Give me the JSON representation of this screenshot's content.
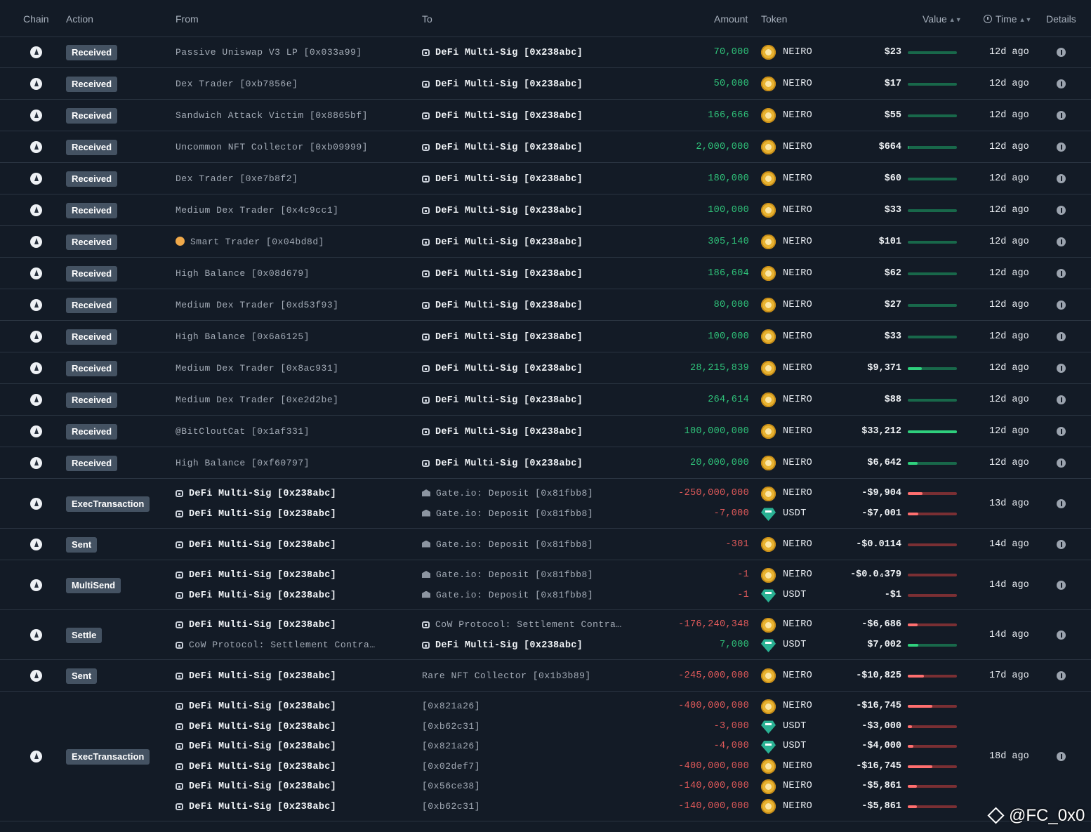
{
  "header": {
    "chain": "Chain",
    "action": "Action",
    "from": "From",
    "to": "To",
    "amount": "Amount",
    "token": "Token",
    "value": "Value",
    "time": "Time",
    "details": "Details"
  },
  "colors": {
    "positive": "#2fc37a",
    "negative": "#e05a5a",
    "badge": "#445262",
    "background": "#131b26"
  },
  "rows": [
    {
      "action": "Received",
      "time": "12d ago",
      "lines": [
        {
          "from": "Passive Uniswap V3 LP [0x033a99]",
          "from_icon": "",
          "from_bright": false,
          "to": "DeFi Multi-Sig [0x238abc]",
          "to_icon": "safe-icon",
          "to_bright": true,
          "amount": "70,000",
          "sign": "pos",
          "token": "NEIRO",
          "coin": "neiro",
          "value": "$23",
          "bar": 0.0
        }
      ]
    },
    {
      "action": "Received",
      "time": "12d ago",
      "lines": [
        {
          "from": "Dex Trader [0xb7856e]",
          "from_icon": "",
          "from_bright": false,
          "to": "DeFi Multi-Sig [0x238abc]",
          "to_icon": "safe-icon",
          "to_bright": true,
          "amount": "50,000",
          "sign": "pos",
          "token": "NEIRO",
          "coin": "neiro",
          "value": "$17",
          "bar": 0.0
        }
      ]
    },
    {
      "action": "Received",
      "time": "12d ago",
      "lines": [
        {
          "from": "Sandwich Attack Victim [0x8865bf]",
          "from_icon": "",
          "from_bright": false,
          "to": "DeFi Multi-Sig [0x238abc]",
          "to_icon": "safe-icon",
          "to_bright": true,
          "amount": "166,666",
          "sign": "pos",
          "token": "NEIRO",
          "coin": "neiro",
          "value": "$55",
          "bar": 0.0
        }
      ]
    },
    {
      "action": "Received",
      "time": "12d ago",
      "lines": [
        {
          "from": "Uncommon NFT Collector [0xb09999]",
          "from_icon": "",
          "from_bright": false,
          "to": "DeFi Multi-Sig [0x238abc]",
          "to_icon": "safe-icon",
          "to_bright": true,
          "amount": "2,000,000",
          "sign": "pos",
          "token": "NEIRO",
          "coin": "neiro",
          "value": "$664",
          "bar": 0.02
        }
      ]
    },
    {
      "action": "Received",
      "time": "12d ago",
      "lines": [
        {
          "from": "Dex Trader [0xe7b8f2]",
          "from_icon": "",
          "from_bright": false,
          "to": "DeFi Multi-Sig [0x238abc]",
          "to_icon": "safe-icon",
          "to_bright": true,
          "amount": "180,000",
          "sign": "pos",
          "token": "NEIRO",
          "coin": "neiro",
          "value": "$60",
          "bar": 0.0
        }
      ]
    },
    {
      "action": "Received",
      "time": "12d ago",
      "lines": [
        {
          "from": "Medium Dex Trader [0x4c9cc1]",
          "from_icon": "",
          "from_bright": false,
          "to": "DeFi Multi-Sig [0x238abc]",
          "to_icon": "safe-icon",
          "to_bright": true,
          "amount": "100,000",
          "sign": "pos",
          "token": "NEIRO",
          "coin": "neiro",
          "value": "$33",
          "bar": 0.0
        }
      ]
    },
    {
      "action": "Received",
      "time": "12d ago",
      "lines": [
        {
          "from": "Smart Trader [0x04bd8d]",
          "from_icon": "smiley-icon",
          "from_bright": false,
          "to": "DeFi Multi-Sig [0x238abc]",
          "to_icon": "safe-icon",
          "to_bright": true,
          "amount": "305,140",
          "sign": "pos",
          "token": "NEIRO",
          "coin": "neiro",
          "value": "$101",
          "bar": 0.0
        }
      ]
    },
    {
      "action": "Received",
      "time": "12d ago",
      "lines": [
        {
          "from": "High Balance [0x08d679]",
          "from_icon": "",
          "from_bright": false,
          "to": "DeFi Multi-Sig [0x238abc]",
          "to_icon": "safe-icon",
          "to_bright": true,
          "amount": "186,604",
          "sign": "pos",
          "token": "NEIRO",
          "coin": "neiro",
          "value": "$62",
          "bar": 0.0
        }
      ]
    },
    {
      "action": "Received",
      "time": "12d ago",
      "lines": [
        {
          "from": "Medium Dex Trader [0xd53f93]",
          "from_icon": "",
          "from_bright": false,
          "to": "DeFi Multi-Sig [0x238abc]",
          "to_icon": "safe-icon",
          "to_bright": true,
          "amount": "80,000",
          "sign": "pos",
          "token": "NEIRO",
          "coin": "neiro",
          "value": "$27",
          "bar": 0.0
        }
      ]
    },
    {
      "action": "Received",
      "time": "12d ago",
      "lines": [
        {
          "from": "High Balance [0x6a6125]",
          "from_icon": "",
          "from_bright": false,
          "to": "DeFi Multi-Sig [0x238abc]",
          "to_icon": "safe-icon",
          "to_bright": true,
          "amount": "100,000",
          "sign": "pos",
          "token": "NEIRO",
          "coin": "neiro",
          "value": "$33",
          "bar": 0.0
        }
      ]
    },
    {
      "action": "Received",
      "time": "12d ago",
      "lines": [
        {
          "from": "Medium Dex Trader [0x8ac931]",
          "from_icon": "",
          "from_bright": false,
          "to": "DeFi Multi-Sig [0x238abc]",
          "to_icon": "safe-icon",
          "to_bright": true,
          "amount": "28,215,839",
          "sign": "pos",
          "token": "NEIRO",
          "coin": "neiro",
          "value": "$9,371",
          "bar": 0.28
        }
      ]
    },
    {
      "action": "Received",
      "time": "12d ago",
      "lines": [
        {
          "from": "Medium Dex Trader [0xe2d2be]",
          "from_icon": "",
          "from_bright": false,
          "to": "DeFi Multi-Sig [0x238abc]",
          "to_icon": "safe-icon",
          "to_bright": true,
          "amount": "264,614",
          "sign": "pos",
          "token": "NEIRO",
          "coin": "neiro",
          "value": "$88",
          "bar": 0.0
        }
      ]
    },
    {
      "action": "Received",
      "time": "12d ago",
      "lines": [
        {
          "from": "@BitCloutCat [0x1af331]",
          "from_icon": "",
          "from_bright": false,
          "to": "DeFi Multi-Sig [0x238abc]",
          "to_icon": "safe-icon",
          "to_bright": true,
          "amount": "100,000,000",
          "sign": "pos",
          "token": "NEIRO",
          "coin": "neiro",
          "value": "$33,212",
          "bar": 1.0
        }
      ]
    },
    {
      "action": "Received",
      "time": "12d ago",
      "lines": [
        {
          "from": "High Balance [0xf60797]",
          "from_icon": "",
          "from_bright": false,
          "to": "DeFi Multi-Sig [0x238abc]",
          "to_icon": "safe-icon",
          "to_bright": true,
          "amount": "20,000,000",
          "sign": "pos",
          "token": "NEIRO",
          "coin": "neiro",
          "value": "$6,642",
          "bar": 0.2
        }
      ]
    },
    {
      "action": "ExecTransaction",
      "time": "13d ago",
      "lines": [
        {
          "from": "DeFi Multi-Sig [0x238abc]",
          "from_icon": "safe-icon",
          "from_bright": true,
          "to": "Gate.io: Deposit [0x81fbb8]",
          "to_icon": "bank-icon",
          "to_bright": false,
          "amount": "-250,000,000",
          "sign": "neg",
          "token": "NEIRO",
          "coin": "neiro",
          "value": "-$9,904",
          "bar": 0.3
        },
        {
          "from": "DeFi Multi-Sig [0x238abc]",
          "from_icon": "safe-icon",
          "from_bright": true,
          "to": "Gate.io: Deposit [0x81fbb8]",
          "to_icon": "bank-icon",
          "to_bright": false,
          "amount": "-7,000",
          "sign": "neg",
          "token": "USDT",
          "coin": "usdt",
          "value": "-$7,001",
          "bar": 0.21
        }
      ]
    },
    {
      "action": "Sent",
      "time": "14d ago",
      "lines": [
        {
          "from": "DeFi Multi-Sig [0x238abc]",
          "from_icon": "safe-icon",
          "from_bright": true,
          "to": "Gate.io: Deposit [0x81fbb8]",
          "to_icon": "bank-icon",
          "to_bright": false,
          "amount": "-301",
          "sign": "neg",
          "token": "NEIRO",
          "coin": "neiro",
          "value": "-$0.0114",
          "bar": 0.0
        }
      ]
    },
    {
      "action": "MultiSend",
      "time": "14d ago",
      "lines": [
        {
          "from": "DeFi Multi-Sig [0x238abc]",
          "from_icon": "safe-icon",
          "from_bright": true,
          "to": "Gate.io: Deposit [0x81fbb8]",
          "to_icon": "bank-icon",
          "to_bright": false,
          "amount": "-1",
          "sign": "neg",
          "token": "NEIRO",
          "coin": "neiro",
          "value": "-$0.0₄379",
          "bar": 0.0
        },
        {
          "from": "DeFi Multi-Sig [0x238abc]",
          "from_icon": "safe-icon",
          "from_bright": true,
          "to": "Gate.io: Deposit [0x81fbb8]",
          "to_icon": "bank-icon",
          "to_bright": false,
          "amount": "-1",
          "sign": "neg",
          "token": "USDT",
          "coin": "usdt",
          "value": "-$1",
          "bar": 0.0
        }
      ]
    },
    {
      "action": "Settle",
      "time": "14d ago",
      "lines": [
        {
          "from": "DeFi Multi-Sig [0x238abc]",
          "from_icon": "safe-icon",
          "from_bright": true,
          "to": "CoW Protocol: Settlement Contra…",
          "to_icon": "safe-icon",
          "to_bright": false,
          "amount": "-176,240,348",
          "sign": "neg",
          "token": "NEIRO",
          "coin": "neiro",
          "value": "-$6,686",
          "bar": 0.2
        },
        {
          "from": "CoW Protocol: Settlement Contra…",
          "from_icon": "safe-icon",
          "from_bright": false,
          "to": "DeFi Multi-Sig [0x238abc]",
          "to_icon": "safe-icon",
          "to_bright": true,
          "amount": "7,000",
          "sign": "pos",
          "token": "USDT",
          "coin": "usdt",
          "value": "$7,002",
          "bar": 0.21
        }
      ]
    },
    {
      "action": "Sent",
      "time": "17d ago",
      "lines": [
        {
          "from": "DeFi Multi-Sig [0x238abc]",
          "from_icon": "safe-icon",
          "from_bright": true,
          "to": "Rare NFT Collector [0x1b3b89]",
          "to_icon": "",
          "to_bright": false,
          "amount": "-245,000,000",
          "sign": "neg",
          "token": "NEIRO",
          "coin": "neiro",
          "value": "-$10,825",
          "bar": 0.33
        }
      ]
    },
    {
      "action": "ExecTransaction",
      "time": "18d ago",
      "lines": [
        {
          "from": "DeFi Multi-Sig [0x238abc]",
          "from_icon": "safe-icon",
          "from_bright": true,
          "to": "[0x821a26]",
          "to_icon": "",
          "to_bright": false,
          "amount": "-400,000,000",
          "sign": "neg",
          "token": "NEIRO",
          "coin": "neiro",
          "value": "-$16,745",
          "bar": 0.5
        },
        {
          "from": "DeFi Multi-Sig [0x238abc]",
          "from_icon": "safe-icon",
          "from_bright": true,
          "to": "[0xb62c31]",
          "to_icon": "",
          "to_bright": false,
          "amount": "-3,000",
          "sign": "neg",
          "token": "USDT",
          "coin": "usdt",
          "value": "-$3,000",
          "bar": 0.09
        },
        {
          "from": "DeFi Multi-Sig [0x238abc]",
          "from_icon": "safe-icon",
          "from_bright": true,
          "to": "[0x821a26]",
          "to_icon": "",
          "to_bright": false,
          "amount": "-4,000",
          "sign": "neg",
          "token": "USDT",
          "coin": "usdt",
          "value": "-$4,000",
          "bar": 0.12
        },
        {
          "from": "DeFi Multi-Sig [0x238abc]",
          "from_icon": "safe-icon",
          "from_bright": true,
          "to": "[0x02def7]",
          "to_icon": "",
          "to_bright": false,
          "amount": "-400,000,000",
          "sign": "neg",
          "token": "NEIRO",
          "coin": "neiro",
          "value": "-$16,745",
          "bar": 0.5
        },
        {
          "from": "DeFi Multi-Sig [0x238abc]",
          "from_icon": "safe-icon",
          "from_bright": true,
          "to": "[0x56ce38]",
          "to_icon": "",
          "to_bright": false,
          "amount": "-140,000,000",
          "sign": "neg",
          "token": "NEIRO",
          "coin": "neiro",
          "value": "-$5,861",
          "bar": 0.18
        },
        {
          "from": "DeFi Multi-Sig [0x238abc]",
          "from_icon": "safe-icon",
          "from_bright": true,
          "to": "[0xb62c31]",
          "to_icon": "",
          "to_bright": false,
          "amount": "-140,000,000",
          "sign": "neg",
          "token": "NEIRO",
          "coin": "neiro",
          "value": "-$5,861",
          "bar": 0.18
        }
      ]
    }
  ],
  "watermark": "@FC_0x0"
}
